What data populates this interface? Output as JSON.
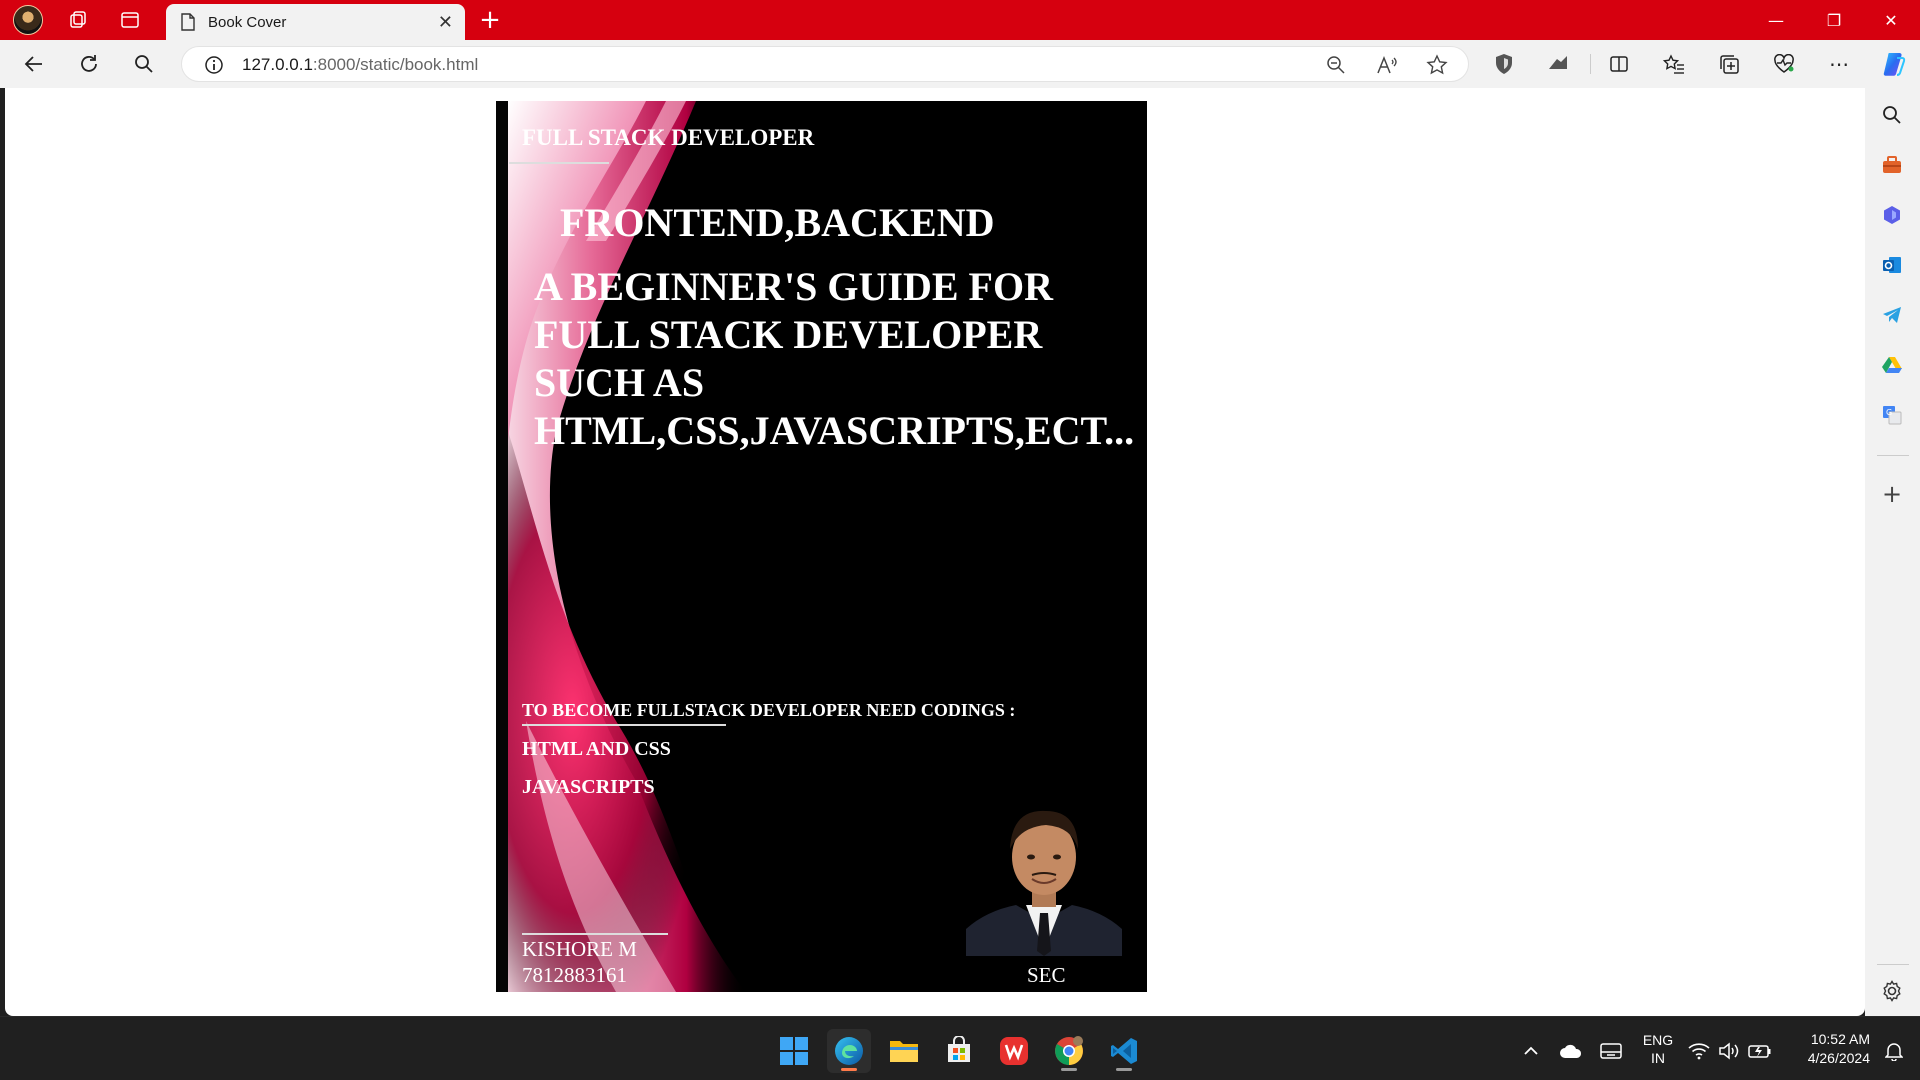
{
  "browser": {
    "tab_title": "Book Cover",
    "close_glyph": "✕",
    "new_tab_glyph": "+",
    "url_host": "127.0.0.1",
    "url_rest": ":8000/static/book.html",
    "accent_color": "#d6000f",
    "window_controls": {
      "minimize": "—",
      "restore": "❐",
      "close": "✕"
    }
  },
  "book": {
    "header": "FULL STACK DEVELOPER",
    "subtitle": "FRONTEND,BACKEND",
    "guide_lines": [
      "A BEGINNER'S GUIDE FOR",
      "FULL STACK DEVELOPER",
      "SUCH AS",
      "HTML,CSS,JAVASCRIPTS,ECT..."
    ],
    "codings_heading": "TO BECOME FULLSTACK DEVELOPER NEED CODINGS :",
    "codings": [
      "HTML AND CSS",
      "JAVASCRIPTS"
    ],
    "author_name": "KISHORE M",
    "author_phone": "7812883161",
    "college": "SEC"
  },
  "taskbar": {
    "lang_line1": "ENG",
    "lang_line2": "IN",
    "time": "10:52 AM",
    "date": "4/26/2024",
    "apps": [
      "windows-start-icon",
      "edge-icon",
      "file-explorer-icon",
      "microsoft-store-icon",
      "wps-office-icon",
      "chrome-icon",
      "vscode-icon"
    ]
  }
}
